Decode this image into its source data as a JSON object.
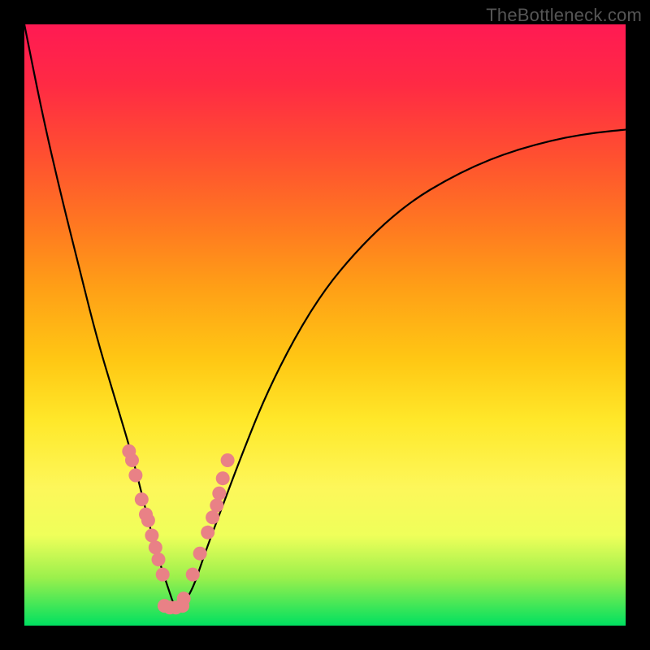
{
  "watermark": "TheBottleneck.com",
  "colors": {
    "frame": "#000000",
    "gradient_top": "#ff1a53",
    "gradient_bottom": "#00e060",
    "curve_stroke": "#000000",
    "dot_fill": "#e98186"
  },
  "chart_data": {
    "type": "line",
    "title": "",
    "xlabel": "",
    "ylabel": "",
    "xlim": [
      0,
      100
    ],
    "ylim": [
      0,
      100
    ],
    "notes": "V-shaped bottleneck curve on a rainbow gradient; minimum near x≈25. Dots cluster along both arms of the V near the trough (roughly y between 4 and 30).",
    "series": [
      {
        "name": "curve",
        "x": [
          0,
          3,
          6,
          9,
          12,
          15,
          18,
          20,
          22,
          24,
          25,
          26,
          28,
          30,
          33,
          36,
          40,
          45,
          50,
          55,
          60,
          65,
          70,
          75,
          80,
          85,
          90,
          95,
          100
        ],
        "y": [
          100,
          85,
          72,
          60,
          48,
          38,
          28,
          20,
          12,
          6,
          3,
          3,
          6,
          12,
          20,
          28,
          38,
          48,
          56,
          62,
          67,
          71,
          74,
          76.5,
          78.5,
          80,
          81.2,
          82,
          82.5
        ]
      },
      {
        "name": "dots",
        "x": [
          17.4,
          17.9,
          18.5,
          19.5,
          20.2,
          20.6,
          21.2,
          21.8,
          22.3,
          23.0,
          26.5,
          28.0,
          29.2,
          30.5,
          31.3,
          32.0,
          32.4,
          33.0,
          33.8,
          23.3,
          24.2,
          25.2,
          26.3
        ],
        "y": [
          29.0,
          27.5,
          25.0,
          21.0,
          18.5,
          17.5,
          15.0,
          13.0,
          11.0,
          8.5,
          4.5,
          8.5,
          12.0,
          15.5,
          18.0,
          20.0,
          22.0,
          24.5,
          27.5,
          3.3,
          3.0,
          3.0,
          3.3
        ]
      }
    ]
  }
}
